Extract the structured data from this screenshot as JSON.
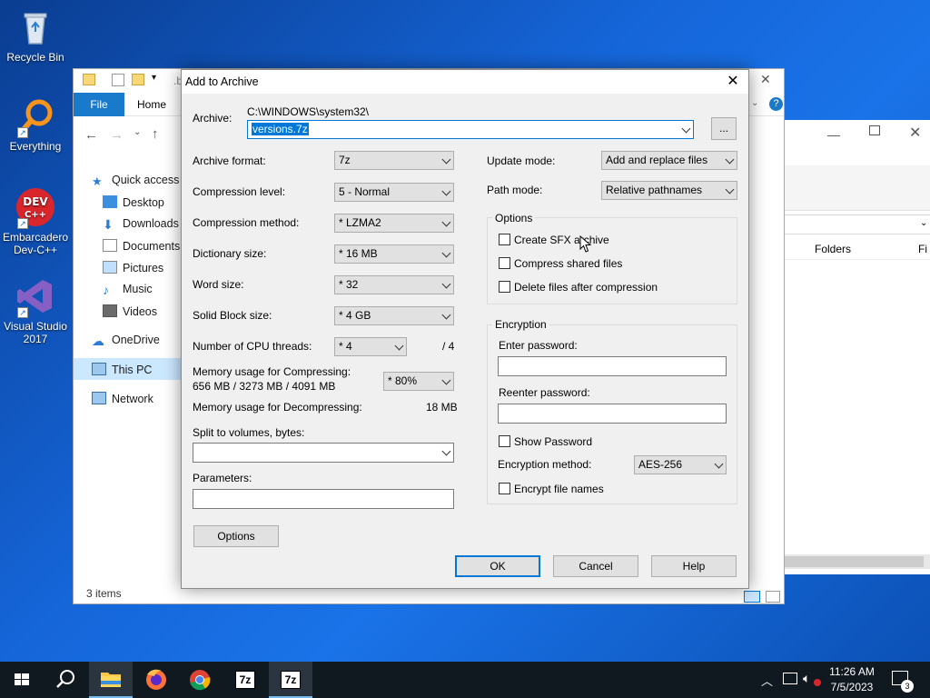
{
  "desktop": {
    "icons": [
      {
        "label": "Recycle Bin"
      },
      {
        "label": "Everything"
      },
      {
        "label": "Embarcadero Dev-C++"
      },
      {
        "label": "Visual Studio 2017"
      }
    ]
  },
  "explorer": {
    "tabs": {
      "file": "File",
      "home": "Home"
    },
    "nav": [
      "Quick access",
      "Desktop",
      "Downloads",
      "Documents",
      "Pictures",
      "Music",
      "Videos",
      "OneDrive",
      "This PC",
      "Network"
    ],
    "status": "3 items",
    "path_fragment": ".b"
  },
  "win2": {
    "col_folders": "Folders",
    "col_fi": "Fi"
  },
  "dialog": {
    "title": "Add to Archive",
    "archive_label": "Archive:",
    "archive_path": "C:\\WINDOWS\\system32\\",
    "archive_name": "versions.7z",
    "browse_label": "...",
    "left": {
      "archive_format": {
        "label": "Archive format:",
        "value": "7z"
      },
      "compression_level": {
        "label": "Compression level:",
        "value": "5 - Normal"
      },
      "compression_method": {
        "label": "Compression method:",
        "value": "* LZMA2"
      },
      "dictionary_size": {
        "label": "Dictionary size:",
        "value": "* 16 MB"
      },
      "word_size": {
        "label": "Word size:",
        "value": "* 32"
      },
      "solid_block_size": {
        "label": "Solid Block size:",
        "value": "* 4 GB"
      },
      "cpu_threads": {
        "label": "Number of CPU threads:",
        "value": "* 4",
        "max": "/ 4"
      },
      "mem_compress": {
        "label": "Memory usage for Compressing:",
        "detail": "656 MB / 3273 MB / 4091 MB",
        "value": "* 80%"
      },
      "mem_decompress": {
        "label": "Memory usage for Decompressing:",
        "value": "18 MB"
      },
      "split_label": "Split to volumes, bytes:",
      "params_label": "Parameters:",
      "options_button": "Options"
    },
    "right": {
      "update_mode": {
        "label": "Update mode:",
        "value": "Add and replace files"
      },
      "path_mode": {
        "label": "Path mode:",
        "value": "Relative pathnames"
      },
      "options_group": "Options",
      "sfx": "Create SFX archive",
      "compress_shared": "Compress shared files",
      "delete_after": "Delete files after compression",
      "encryption_group": "Encryption",
      "enter_password": "Enter password:",
      "reenter_password": "Reenter password:",
      "show_password": "Show Password",
      "encryption_method": {
        "label": "Encryption method:",
        "value": "AES-256"
      },
      "encrypt_names": "Encrypt file names"
    },
    "buttons": {
      "ok": "OK",
      "cancel": "Cancel",
      "help": "Help"
    }
  },
  "taskbar": {
    "time": "11:26 AM",
    "date": "7/5/2023",
    "notifications": "3",
    "app_7z_1": "7z",
    "app_7z_2": "7z"
  }
}
